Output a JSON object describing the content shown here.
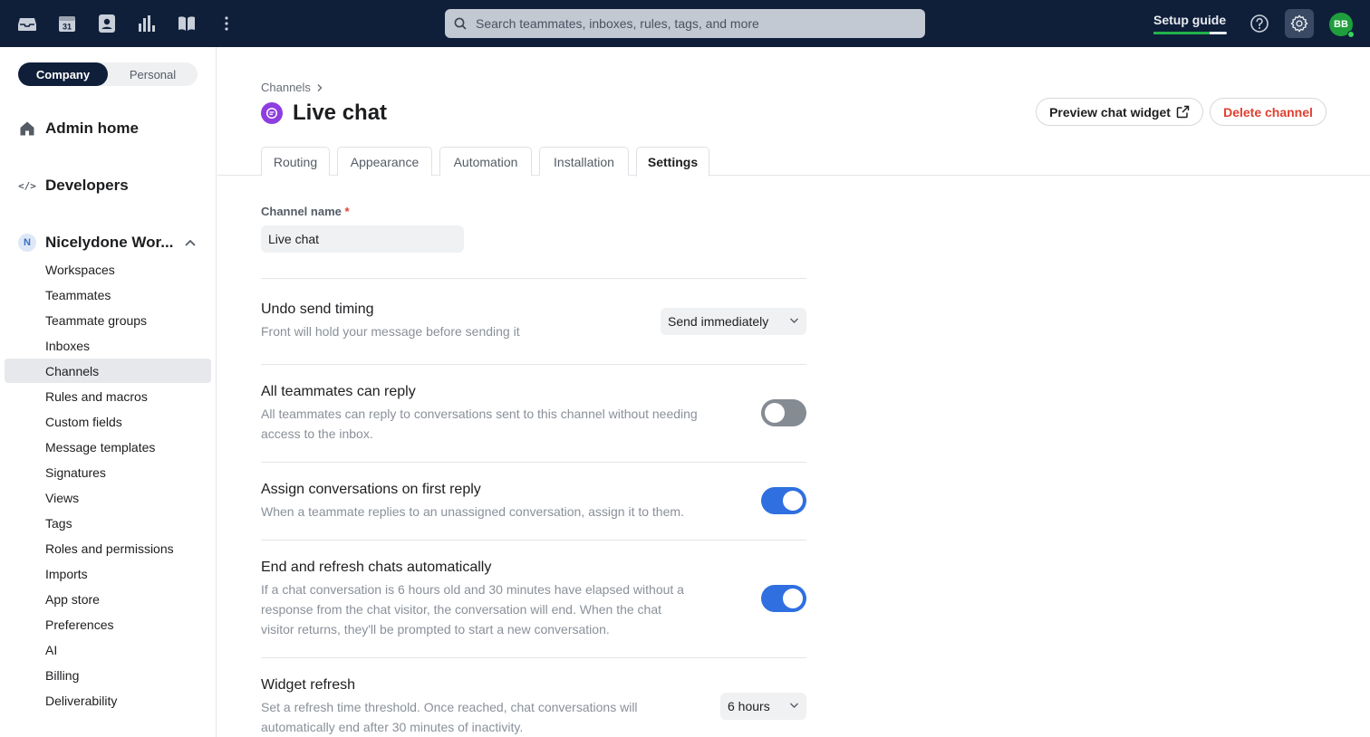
{
  "topbar": {
    "search_placeholder": "Search teammates, inboxes, rules, tags, and more",
    "setup_guide": "Setup guide",
    "setup_progress": 0.76,
    "avatar_initials": "BB",
    "calendar_day": "31"
  },
  "sidebar": {
    "segments": {
      "company": "Company",
      "personal": "Personal"
    },
    "admin_home": "Admin home",
    "developers": "Developers",
    "developers_icon_text": "</>",
    "workspace_badge": "N",
    "workspace_name": "Nicelydone Wor...",
    "items": [
      "Workspaces",
      "Teammates",
      "Teammate groups",
      "Inboxes",
      "Channels",
      "Rules and macros",
      "Custom fields",
      "Message templates",
      "Signatures",
      "Views",
      "Tags",
      "Roles and permissions",
      "Imports",
      "App store",
      "Preferences",
      "AI",
      "Billing",
      "Deliverability"
    ],
    "active_item": "Channels"
  },
  "main": {
    "breadcrumb": "Channels",
    "title": "Live chat",
    "preview_button": "Preview chat widget",
    "delete_button": "Delete channel",
    "tabs": [
      "Routing",
      "Appearance",
      "Automation",
      "Installation",
      "Settings"
    ],
    "active_tab": "Settings",
    "channel_name_label": "Channel name",
    "required_mark": "*",
    "channel_name_value": "Live chat",
    "settings": [
      {
        "title": "Undo send timing",
        "desc": "Front will hold your message before sending it",
        "control": "select",
        "value": "Send immediately"
      },
      {
        "title": "All teammates can reply",
        "desc_lines": [
          "All teammates can reply to conversations sent to this channel without needing",
          "access to the inbox."
        ],
        "control": "toggle",
        "value": false
      },
      {
        "title": "Assign conversations on first reply",
        "desc": "When a teammate replies to an unassigned conversation, assign it to them.",
        "control": "toggle",
        "value": true
      },
      {
        "title": "End and refresh chats automatically",
        "desc_lines": [
          "If a chat conversation is 6 hours old and 30 minutes have elapsed without a",
          "response from the chat visitor, the conversation will end. When the chat",
          "visitor returns, they'll be prompted to start a new conversation."
        ],
        "control": "toggle",
        "value": true
      },
      {
        "title": "Widget refresh",
        "desc_lines": [
          "Set a refresh time threshold. Once reached, chat conversations will",
          "automatically end after 30 minutes of inactivity."
        ],
        "control": "select",
        "value": "6 hours"
      }
    ]
  },
  "colors": {
    "topbar_bg": "#0f1f3a",
    "accent_blue": "#2f6fe0",
    "delete_red": "#e0402f",
    "channel_purple": "#8e3ee0",
    "progress_green": "#21b24a"
  }
}
